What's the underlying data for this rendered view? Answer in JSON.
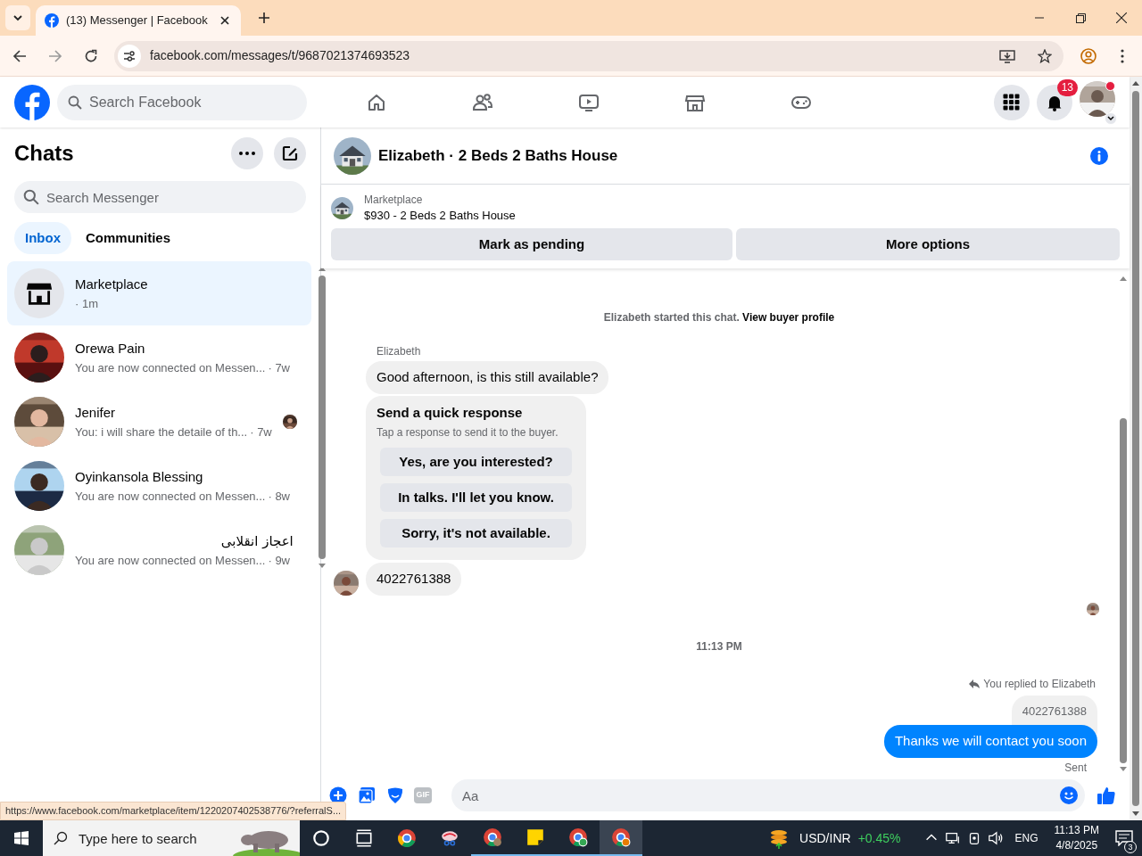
{
  "browser": {
    "tab_title": "(13) Messenger | Facebook",
    "url": "facebook.com/messages/t/9687021374693523"
  },
  "header": {
    "search_placeholder": "Search Facebook",
    "notification_count": "13"
  },
  "chats": {
    "title": "Chats",
    "search_placeholder": "Search Messenger",
    "tabs": [
      {
        "label": "Inbox",
        "selected": true
      },
      {
        "label": "Communities",
        "selected": false
      }
    ],
    "conversations": [
      {
        "name": "Marketplace",
        "time": "· 1m",
        "selected": true,
        "kind": "store",
        "seen": false
      },
      {
        "name": "Orewa Pain",
        "preview": "You are now connected on Messen...",
        "time": "· 7w",
        "selected": false,
        "seen": false
      },
      {
        "name": "Jenifer",
        "preview": "You: i will share the detaile of th...",
        "time": "· 7w",
        "selected": false,
        "seen": true
      },
      {
        "name": "Oyinkansola Blessing",
        "preview": "You are now connected on Messen...",
        "time": "· 8w",
        "selected": false,
        "seen": false
      },
      {
        "name": "اعجاز انقلابی",
        "preview": "You are now connected on Messen...",
        "time": "· 9w",
        "selected": false,
        "seen": false
      }
    ]
  },
  "chat": {
    "title": "Elizabeth · 2 Beds 2 Baths House",
    "listing": {
      "label": "Marketplace",
      "title": "$930 - 2 Beds 2 Baths House"
    },
    "actions": [
      "Mark as pending",
      "More options"
    ],
    "messages": [
      {
        "kind": "system",
        "text": "Elizabeth started this chat.",
        "link": "View buyer profile"
      },
      {
        "kind": "sender",
        "text": "Elizabeth"
      },
      {
        "kind": "incoming",
        "text": "Good afternoon, is this still available?"
      },
      {
        "kind": "quick_response",
        "title": "Send a quick response",
        "subtitle": "Tap a response to send it to the buyer.",
        "options": [
          "Yes, are you interested?",
          "In talks. I'll let you know.",
          "Sorry, it's not available."
        ]
      },
      {
        "kind": "incoming",
        "text": "4022761388",
        "avatar": true
      },
      {
        "kind": "seen"
      },
      {
        "kind": "timestamp",
        "text": "11:13 PM"
      },
      {
        "kind": "reply_note",
        "text": "You replied to Elizabeth"
      },
      {
        "kind": "quoted",
        "text": "4022761388"
      },
      {
        "kind": "outgoing",
        "text": "Thanks we will contact you soon"
      },
      {
        "kind": "status",
        "text": "Sent"
      }
    ],
    "composer": {
      "gif_label": "GIF",
      "placeholder": "Aa"
    }
  },
  "status_url": "https://www.facebook.com/marketplace/item/1220207402538776/?referralS...",
  "taskbar": {
    "search_placeholder": "Type here to search",
    "ticker_label": "USD/INR",
    "ticker_change": "+0.45%",
    "language": "ENG",
    "time": "11:13 PM",
    "date": "4/8/2025",
    "notification_count": "3"
  }
}
